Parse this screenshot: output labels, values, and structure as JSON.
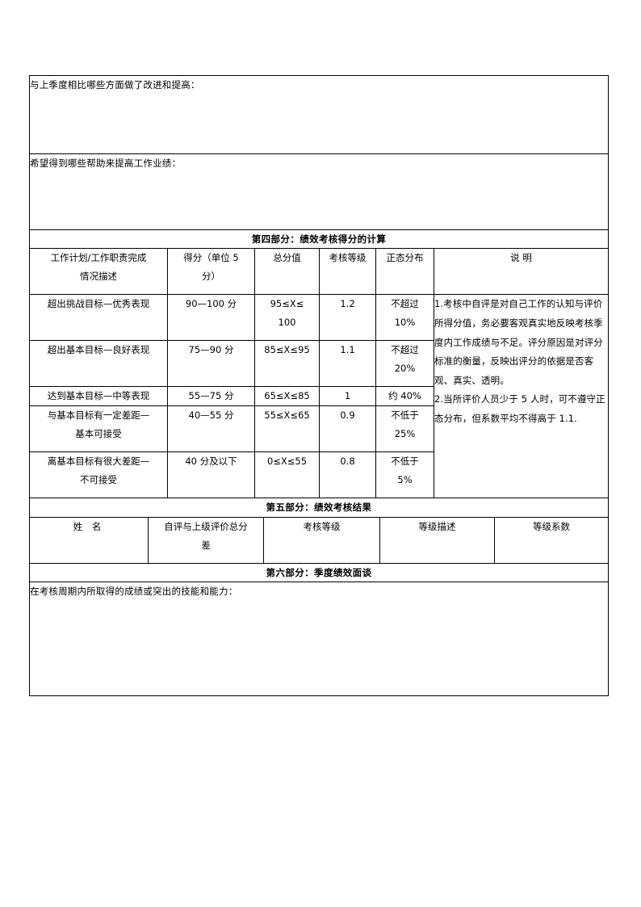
{
  "document": {
    "type": "performance-appraisal-form"
  },
  "open_questions": {
    "improvement_prompt": "与上季度相比哪些方面做了改进和提高：",
    "support_prompt": "希望得到哪些帮助来提高工作业绩："
  },
  "section4": {
    "title": "第四部分：绩效考核得分的计算",
    "columns": [
      "工作计划/工作职责完成情况描述",
      "得分（单位 5 分）",
      "总分值",
      "考核等级",
      "正态分布",
      "说 明"
    ],
    "columns_display": {
      "c1_line1": "工作计划/工作职责完成",
      "c1_line2": "情况描述",
      "c2_line1": "得分（单位 5",
      "c2_line2": "分）",
      "c3": "总分值",
      "c4": "考核等级",
      "c5": "正态分布",
      "c6": "说 明"
    },
    "rows": [
      {
        "description_line1": "超出挑战目标—优秀表现",
        "description_line2": "",
        "score": "90—100 分",
        "total_line1": "95≤X≤",
        "total_line2": "100",
        "grade": "1.2",
        "distribution_line1": "不超过",
        "distribution_line2": "10%"
      },
      {
        "description_line1": "超出基本目标—良好表现",
        "description_line2": "",
        "score": "75—90 分",
        "total_line1": "85≤X≤95",
        "total_line2": "",
        "grade": "1.1",
        "distribution_line1": "不超过",
        "distribution_line2": "20%"
      },
      {
        "description_line1": "达到基本目标—中等表现",
        "description_line2": "",
        "score": "55—75 分",
        "total_line1": "65≤X≤85",
        "total_line2": "",
        "grade": "1",
        "distribution_line1": "约 40%",
        "distribution_line2": ""
      },
      {
        "description_line1": "与基本目标有一定差距—",
        "description_line2": "基本可接受",
        "score": "40—55 分",
        "total_line1": "55≤X≤65",
        "total_line2": "",
        "grade": "0.9",
        "distribution_line1": "不低于",
        "distribution_line2": "25%"
      },
      {
        "description_line1": "离基本目标有很大差距—",
        "description_line2": "不可接受",
        "score": "40 分及以下",
        "total_line1": "0≤X≤55",
        "total_line2": "",
        "grade": "0.8",
        "distribution_line1": "不低于",
        "distribution_line2": "5%"
      }
    ],
    "note_paragraph_1": "1.考核中自评是对自己工作的认知与评价所得分值，务必要客观真实地反映考核季度内工作成绩与不足。评分原因是对评分标准的衡量，反映出评分的依据是否客观、真实、透明。",
    "note_paragraph_2": "2.当所评价人员少于 5 人时，可不遵守正态分布，但系数平均不得高于 1.1."
  },
  "section5": {
    "title": "第五部分：绩效考核结果",
    "columns": [
      "姓 名",
      "自评与上级评价总分差",
      "考核等级",
      "等级描述",
      "等级系数"
    ],
    "columns_display": {
      "c1": "姓 名",
      "c2_line1": "自评与上级评价总分",
      "c2_line2": "差",
      "c3": "考核等级",
      "c4": "等级描述",
      "c5": "等级系数"
    },
    "values": [
      "",
      "",
      "",
      "",
      ""
    ]
  },
  "section6": {
    "title": "第六部分：季度绩效面谈",
    "prompt": "在考核周期内所取得的成绩或突出的技能和能力："
  }
}
